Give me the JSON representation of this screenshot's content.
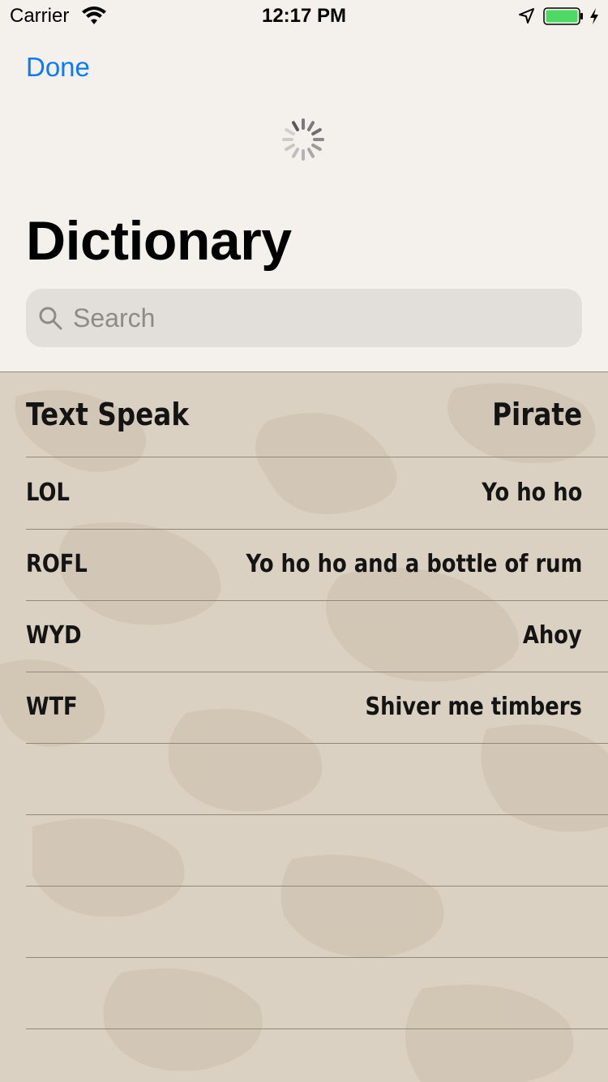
{
  "status_bar": {
    "carrier": "Carrier",
    "time": "12:17 PM"
  },
  "nav": {
    "done_label": "Done",
    "title": "Dictionary"
  },
  "search": {
    "placeholder": "Search",
    "value": ""
  },
  "table": {
    "header": {
      "left": "Text Speak",
      "right": "Pirate"
    },
    "rows": [
      {
        "left": "LOL",
        "right": "Yo ho ho"
      },
      {
        "left": "ROFL",
        "right": "Yo ho ho and a bottle of rum"
      },
      {
        "left": "WYD",
        "right": "Ahoy"
      },
      {
        "left": "WTF",
        "right": "Shiver me timbers"
      },
      {
        "left": "",
        "right": ""
      },
      {
        "left": "",
        "right": ""
      },
      {
        "left": "",
        "right": ""
      },
      {
        "left": "",
        "right": ""
      }
    ]
  },
  "colors": {
    "accent": "#0a7aff",
    "battery": "#4cd964",
    "parchment": "#dbd1c2"
  },
  "icons": [
    "wifi-icon",
    "location-icon",
    "battery-icon",
    "bolt-icon",
    "spinner-icon",
    "search-icon"
  ]
}
